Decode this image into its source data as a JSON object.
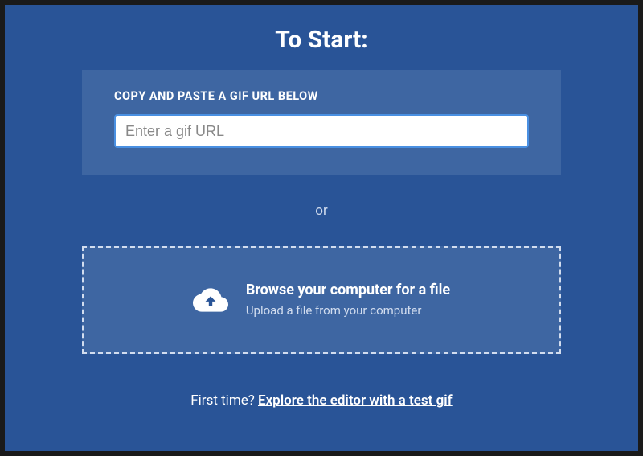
{
  "title": "To Start:",
  "url_section": {
    "label": "COPY AND PASTE A GIF URL BELOW",
    "placeholder": "Enter a gif URL",
    "value": ""
  },
  "or_text": "or",
  "upload_section": {
    "title": "Browse your computer for a file",
    "subtitle": "Upload a file from your computer",
    "icon_name": "cloud-upload-icon"
  },
  "footer": {
    "prefix": "First time? ",
    "link_text": "Explore the editor with a test gif"
  },
  "colors": {
    "panel_bg": "#295497",
    "box_bg": "#3e66a2",
    "dashed_border": "#d2ddef"
  }
}
